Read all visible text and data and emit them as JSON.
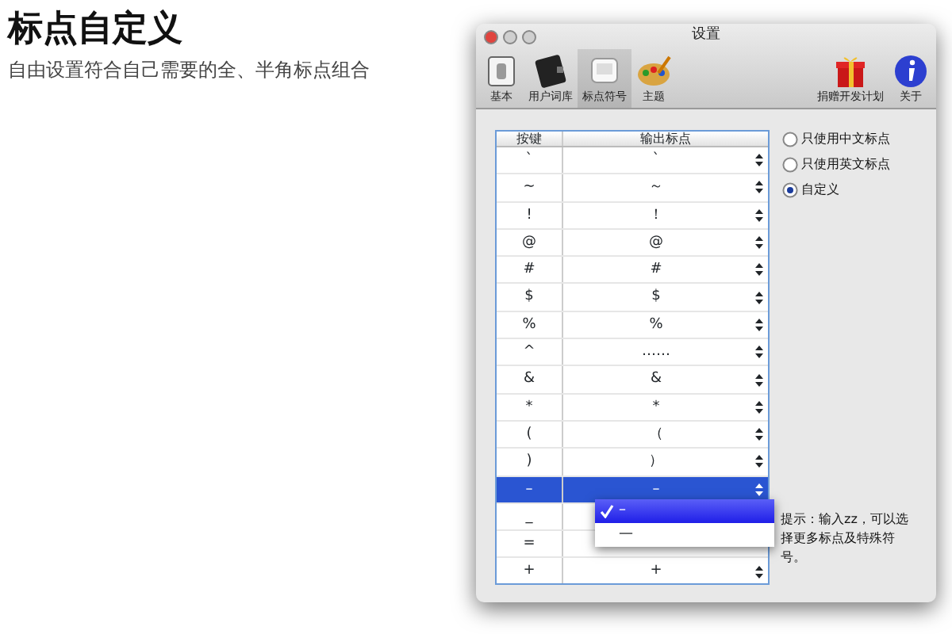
{
  "page": {
    "title": "标点自定义",
    "subtitle": "自由设置符合自己需要的全、半角标点组合"
  },
  "window": {
    "title": "设置"
  },
  "toolbar": [
    {
      "label": "基本",
      "kind": "switch",
      "selected": false
    },
    {
      "label": "用户词库",
      "kind": "book",
      "selected": false
    },
    {
      "label": "标点符号",
      "kind": "key",
      "selected": true
    },
    {
      "label": "主题",
      "kind": "palette",
      "selected": false
    },
    {
      "label": "捐赠开发计划",
      "kind": "gift",
      "selected": false
    },
    {
      "label": "关于",
      "kind": "info",
      "selected": false
    }
  ],
  "table": {
    "columns": [
      "按键",
      "输出标点"
    ],
    "rows": [
      {
        "key": "`",
        "output": "`",
        "selected": false
      },
      {
        "key": "~",
        "output": "～",
        "selected": false
      },
      {
        "key": "!",
        "output": "！",
        "selected": false
      },
      {
        "key": "@",
        "output": "@",
        "selected": false
      },
      {
        "key": "#",
        "output": "#",
        "selected": false
      },
      {
        "key": "$",
        "output": "$",
        "selected": false
      },
      {
        "key": "%",
        "output": "%",
        "selected": false
      },
      {
        "key": "^",
        "output": "……",
        "selected": false
      },
      {
        "key": "&",
        "output": "&",
        "selected": false
      },
      {
        "key": "*",
        "output": "*",
        "selected": false
      },
      {
        "key": "(",
        "output": "（",
        "selected": false
      },
      {
        "key": ")",
        "output": "）",
        "selected": false
      },
      {
        "key": "–",
        "output": "–",
        "selected": true
      },
      {
        "key": "_",
        "selected": false
      },
      {
        "key": "=",
        "selected": false
      },
      {
        "key": "+",
        "output": "+",
        "selected": false
      }
    ]
  },
  "dropdown": [
    {
      "label": "–",
      "selected": true
    },
    {
      "label": "—",
      "selected": false
    }
  ],
  "modes": [
    {
      "label": "只使用中文标点",
      "selected": false
    },
    {
      "label": "只使用英文标点",
      "selected": false
    },
    {
      "label": "自定义",
      "selected": true
    }
  ],
  "hint": "提示：输入zz，可以选择更多标点及特殊符号。"
}
